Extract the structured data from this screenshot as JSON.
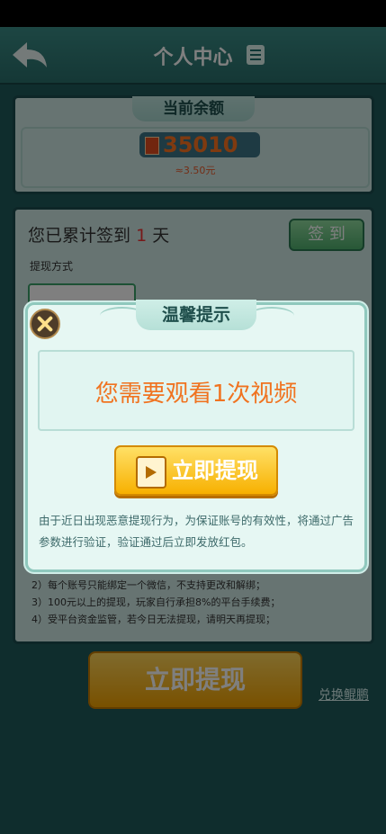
{
  "header": {
    "title": "个人中心",
    "back_icon": "back-arrow-icon",
    "title_icon": "document-icon"
  },
  "balance": {
    "label": "当前余额",
    "coins": "35010",
    "rmb": "≈3.50元"
  },
  "signin": {
    "prefix": "您已累计签到",
    "days": "1",
    "suffix": "天",
    "button": "签 到",
    "method_label": "提现方式"
  },
  "rules": [
    "2）每个账号只能绑定一个微信，不支持更改和解绑；",
    "3）100元以上的提现，玩家自行承担8%的平台手续费；",
    "4）受平台资金监管，若今日无法提现，请明天再提现；"
  ],
  "footer": {
    "withdraw_label": "立即提现",
    "exchange_label": "兑换鲲鹏"
  },
  "modal": {
    "title": "温馨提示",
    "message": "您需要观看1次视频",
    "cta": "立即提现",
    "notice": "由于近日出现恶意提现行为，为保证账号的有效性，将通过广告参数进行验证，验证通过后立即发放红包。"
  },
  "colors": {
    "accent": "#f07320",
    "header_bg": "#2a706c",
    "cta_gold": "#f7b000"
  }
}
